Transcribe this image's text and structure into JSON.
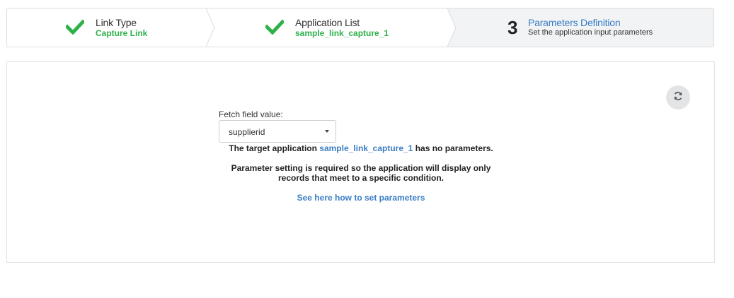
{
  "wizard": {
    "steps": [
      {
        "title": "Link Type",
        "subtitle": "Capture Link",
        "status": "done"
      },
      {
        "title": "Application List",
        "subtitle": "sample_link_capture_1",
        "status": "done"
      },
      {
        "number": "3",
        "title": "Parameters Definition",
        "description": "Set the application input parameters",
        "status": "active"
      }
    ]
  },
  "panel": {
    "refresh_icon": "refresh-icon",
    "fetch_label": "Fetch field value:",
    "fetch_select": {
      "value": "supplierid"
    },
    "message_prefix": "The target application",
    "message_app": "sample_link_capture_1",
    "message_suffix": "has no parameters.",
    "message_line2a": "Parameter setting is required so the application will display only",
    "message_line2b": "records that meet to a specific condition.",
    "help_link": "See here how to set parameters"
  },
  "colors": {
    "success": "#2db14a",
    "accent": "#3a7dc4",
    "active_step_bg": "#f2f3f5"
  }
}
